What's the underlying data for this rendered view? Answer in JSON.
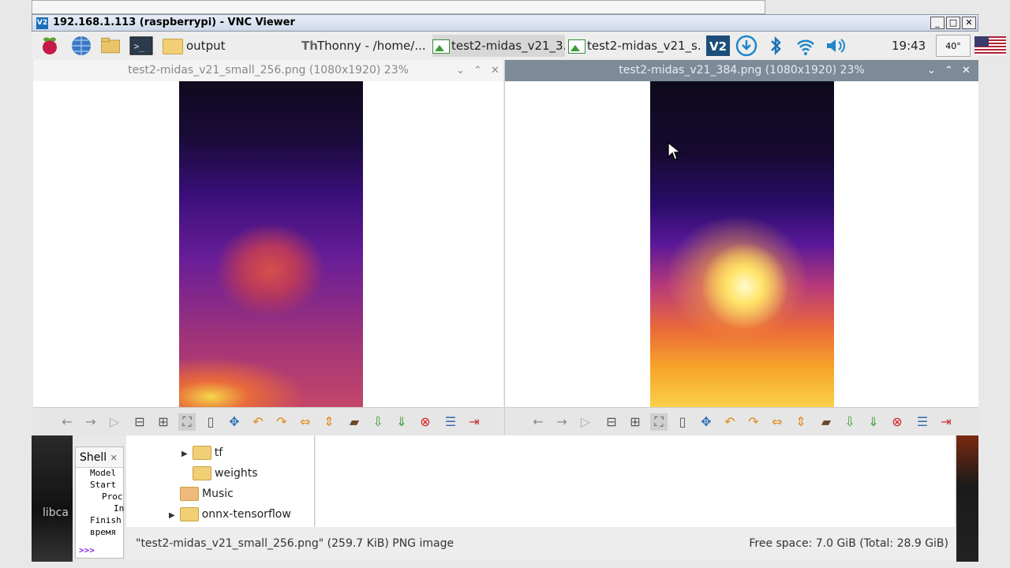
{
  "vnc": {
    "title": "192.168.1.113 (raspberrypi) - VNC Viewer",
    "logo": "V2",
    "minimize": "_",
    "maximize": "□",
    "close": "✕"
  },
  "panel": {
    "launchers": [
      "raspberry-menu-icon",
      "web-browser-icon",
      "file-manager-icon",
      "terminal-icon"
    ],
    "tasks": [
      {
        "label": "output",
        "icon": "folder-icon"
      },
      {
        "label": "Thonny  -  /home/...",
        "icon": "thonny-icon"
      },
      {
        "label": "test2-midas_v21_3...",
        "icon": "image-icon"
      },
      {
        "label": "test2-midas_v21_s...",
        "icon": "image-icon"
      }
    ],
    "tray": [
      "vnc-server-icon",
      "updates-icon",
      "bluetooth-icon",
      "wifi-icon",
      "volume-icon"
    ],
    "clock": "19:43",
    "temp": "40°",
    "flag": "keyboard-layout-us-flag"
  },
  "viewer_left": {
    "title": "test2-midas_v21_small_256.png (1080x1920) 23%",
    "ctrl_min": "⌄",
    "ctrl_max": "⌃",
    "ctrl_close": "✕"
  },
  "viewer_right": {
    "title": "test2-midas_v21_384.png (1080x1920) 23%",
    "ctrl_min": "⌄",
    "ctrl_max": "⌃",
    "ctrl_close": "✕"
  },
  "toolbar_icons": [
    "back",
    "forward",
    "play",
    "zoom-out",
    "zoom-in",
    "fit",
    "original-size",
    "fullscreen",
    "rotate-left",
    "rotate-right",
    "flip-h",
    "flip-v",
    "open",
    "save",
    "save-as",
    "delete",
    "preferences",
    "quit"
  ],
  "shell": {
    "tab": "Shell",
    "close": "✕",
    "lines": [
      "Model",
      "Start",
      "Proc",
      "In",
      "Finish",
      "время"
    ],
    "prompt": ">>>"
  },
  "tree": [
    {
      "label": "tf",
      "indent": 1,
      "expander": true
    },
    {
      "label": "weights",
      "indent": 1,
      "expander": false
    },
    {
      "label": "Music",
      "indent": 0,
      "expander": false
    },
    {
      "label": "onnx-tensorflow",
      "indent": 0,
      "expander": true
    }
  ],
  "status": {
    "left": "\"test2-midas_v21_small_256.png\" (259.7 KiB) PNG image",
    "right": "Free space: 7.0 GiB (Total: 28.9 GiB)"
  },
  "desktop_label": "libca"
}
